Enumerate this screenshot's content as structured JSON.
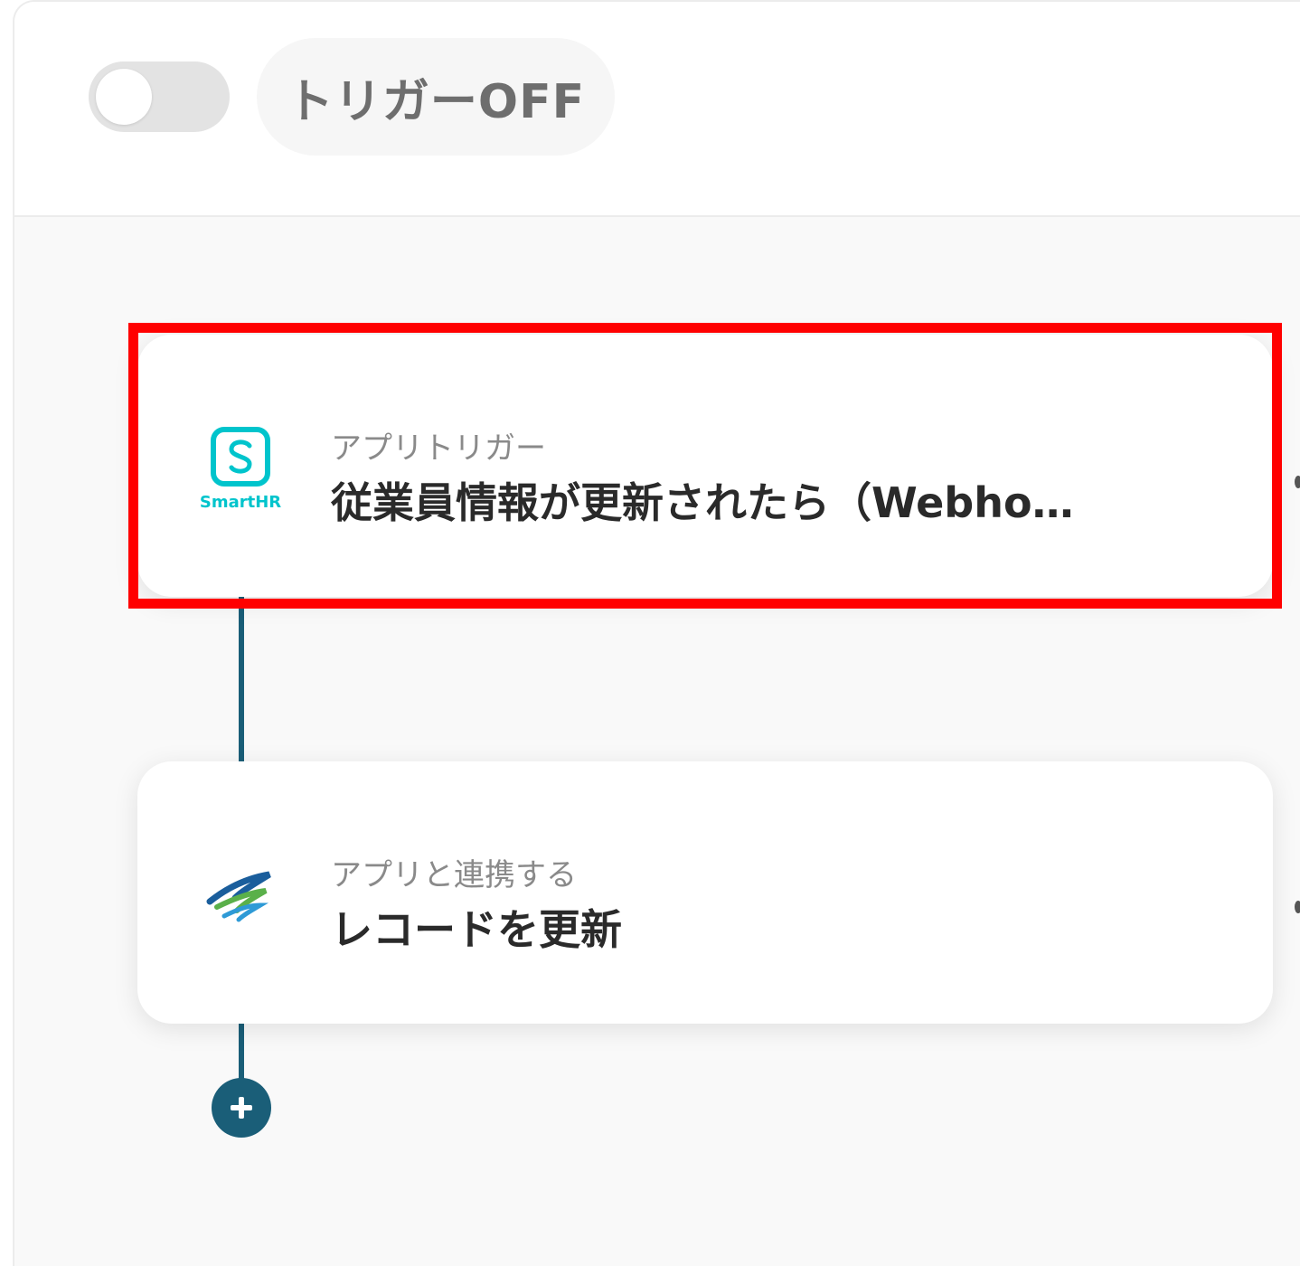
{
  "header": {
    "trigger_toggle": {
      "state": "off",
      "label": "トリガーOFF"
    }
  },
  "flow": {
    "steps": [
      {
        "app": "SmartHR",
        "category": "アプリトリガー",
        "title": "従業員情報が更新されたら（Webho…",
        "icon": "smarthr-logo-icon",
        "brand_color": "#00c4cc"
      },
      {
        "app": "",
        "category": "アプリと連携する",
        "title": "レコードを更新",
        "icon": "app-swirl-logo-icon"
      }
    ],
    "add_step_icon": "plus-icon"
  },
  "colors": {
    "connector": "#1a5e78",
    "highlight": "#ff0000",
    "toggle_off_track": "#e3e3e3"
  }
}
